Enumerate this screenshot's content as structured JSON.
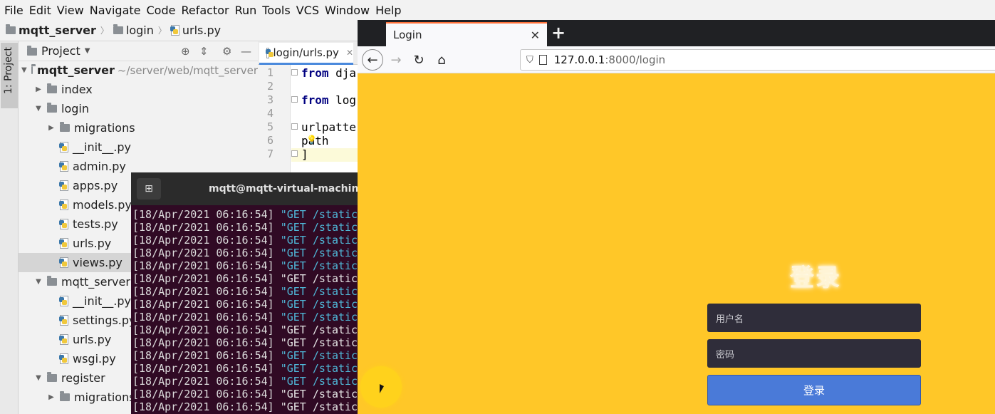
{
  "menubar": [
    "File",
    "Edit",
    "View",
    "Navigate",
    "Code",
    "Refactor",
    "Run",
    "Tools",
    "VCS",
    "Window",
    "Help"
  ],
  "breadcrumb": [
    "mqtt_server",
    "login",
    "urls.py"
  ],
  "tool_stripe": {
    "project_label": "1: Project"
  },
  "project_panel": {
    "title": "Project",
    "tree": [
      {
        "label": "mqtt_server",
        "path": "~/server/web/mqtt_server",
        "kind": "root",
        "depth": 0,
        "expanded": true
      },
      {
        "label": "index",
        "kind": "folder",
        "depth": 1,
        "expanded": false
      },
      {
        "label": "login",
        "kind": "folder",
        "depth": 1,
        "expanded": true
      },
      {
        "label": "migrations",
        "kind": "folder",
        "depth": 2,
        "expanded": false
      },
      {
        "label": "__init__.py",
        "kind": "file",
        "depth": 2
      },
      {
        "label": "admin.py",
        "kind": "file",
        "depth": 2
      },
      {
        "label": "apps.py",
        "kind": "file",
        "depth": 2
      },
      {
        "label": "models.py",
        "kind": "file",
        "depth": 2
      },
      {
        "label": "tests.py",
        "kind": "file",
        "depth": 2
      },
      {
        "label": "urls.py",
        "kind": "file",
        "depth": 2
      },
      {
        "label": "views.py",
        "kind": "file",
        "depth": 2,
        "selected": true
      },
      {
        "label": "mqtt_server",
        "kind": "folder",
        "depth": 1,
        "expanded": true
      },
      {
        "label": "__init__.py",
        "kind": "file",
        "depth": 2
      },
      {
        "label": "settings.py",
        "kind": "file",
        "depth": 2
      },
      {
        "label": "urls.py",
        "kind": "file",
        "depth": 2
      },
      {
        "label": "wsgi.py",
        "kind": "file",
        "depth": 2
      },
      {
        "label": "register",
        "kind": "folder",
        "depth": 1,
        "expanded": true
      },
      {
        "label": "migrations",
        "kind": "folder",
        "depth": 2,
        "expanded": false
      }
    ]
  },
  "editor": {
    "tab_label": "login/urls.py",
    "line_numbers": [
      "1",
      "2",
      "3",
      "4",
      "5",
      "6",
      "7"
    ],
    "lines": [
      {
        "kw": "from",
        "text": " dja"
      },
      {
        "kw": "",
        "text": ""
      },
      {
        "kw": "from",
        "text": " log"
      },
      {
        "kw": "",
        "text": ""
      },
      {
        "kw": "",
        "text": "urlpatte"
      },
      {
        "kw": "",
        "text": "    path"
      },
      {
        "kw": "",
        "text": "]"
      }
    ]
  },
  "terminal": {
    "title": "mqtt@mqtt-virtual-machine:",
    "new_tab_icon": "terminal-new-tab-icon",
    "log_lines": [
      {
        "time": "[18/Apr/2021 06:16:54]",
        "req": " \"GET /static",
        "color": "cyan"
      },
      {
        "time": "[18/Apr/2021 06:16:54]",
        "req": " \"GET /static",
        "color": "cyan"
      },
      {
        "time": "[18/Apr/2021 06:16:54]",
        "req": " \"GET /static",
        "color": "cyan"
      },
      {
        "time": "[18/Apr/2021 06:16:54]",
        "req": " \"GET /static",
        "color": "cyan"
      },
      {
        "time": "[18/Apr/2021 06:16:54]",
        "req": " \"GET /static",
        "color": "cyan"
      },
      {
        "time": "[18/Apr/2021 06:16:54]",
        "req": " \"GET /static",
        "color": "white"
      },
      {
        "time": "[18/Apr/2021 06:16:54]",
        "req": " \"GET /static",
        "color": "cyan"
      },
      {
        "time": "[18/Apr/2021 06:16:54]",
        "req": " \"GET /static",
        "color": "cyan"
      },
      {
        "time": "[18/Apr/2021 06:16:54]",
        "req": " \"GET /static",
        "color": "cyan"
      },
      {
        "time": "[18/Apr/2021 06:16:54]",
        "req": " \"GET /static",
        "color": "white"
      },
      {
        "time": "[18/Apr/2021 06:16:54]",
        "req": " \"GET /static",
        "color": "white"
      },
      {
        "time": "[18/Apr/2021 06:16:54]",
        "req": " \"GET /static",
        "color": "cyan"
      },
      {
        "time": "[18/Apr/2021 06:16:54]",
        "req": " \"GET /static",
        "color": "cyan"
      },
      {
        "time": "[18/Apr/2021 06:16:54]",
        "req": " \"GET /static",
        "color": "cyan"
      },
      {
        "time": "[18/Apr/2021 06:16:54]",
        "req": " \"GET /static",
        "color": "white"
      },
      {
        "time": "[18/Apr/2021 06:16:54]",
        "req": " \"GET /static",
        "color": "white"
      }
    ]
  },
  "browser": {
    "tab_title": "Login",
    "url_host": "127.0.0.1",
    "url_rest": ":8000/login",
    "page_bg": "#ffc728"
  },
  "login": {
    "title": "登录",
    "username_placeholder": "用户名",
    "password_placeholder": "密码",
    "submit_label": "登录"
  },
  "colors": {
    "terminal_bg": "#300a24",
    "login_button": "#4a7ad8",
    "field_bg": "#2f2d3a"
  }
}
